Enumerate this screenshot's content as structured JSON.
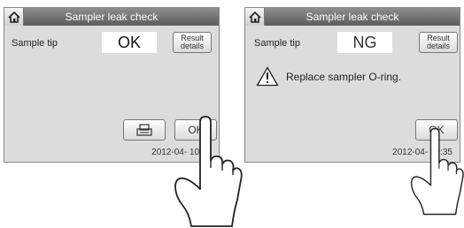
{
  "screens": [
    {
      "title": "Sampler leak check",
      "sample_label": "Sample tip",
      "status": "OK",
      "result_details_line1": "Result",
      "result_details_line2": "details",
      "ok_label": "OK",
      "timestamp": "2012-04-  10:35"
    },
    {
      "title": "Sampler leak check",
      "sample_label": "Sample tip",
      "status": "NG",
      "result_details_line1": "Result",
      "result_details_line2": "details",
      "message": "Replace sampler O-ring.",
      "ok_label": "OK",
      "timestamp": "2012-04-  10:35"
    }
  ],
  "icons": [
    "home-icon",
    "printer-icon",
    "warning-icon",
    "pointing-hand-icon"
  ]
}
